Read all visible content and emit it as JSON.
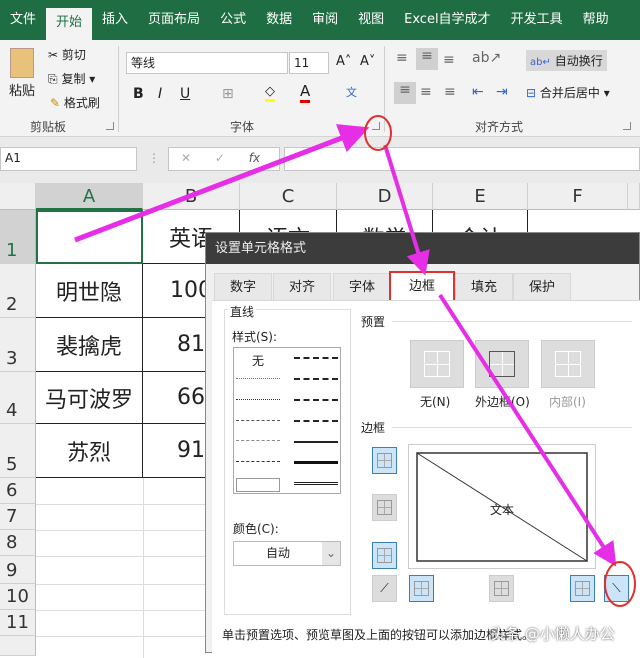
{
  "ribbon_tabs": [
    "文件",
    "开始",
    "插入",
    "页面布局",
    "公式",
    "数据",
    "审阅",
    "视图",
    "Excel自学成才",
    "开发工具",
    "帮助"
  ],
  "clipboard": {
    "paste": "粘贴",
    "cut": "剪切",
    "copy": "复制",
    "format_painter": "格式刷",
    "group": "剪贴板"
  },
  "font": {
    "name": "等线",
    "size": "11",
    "bold": "B",
    "italic": "I",
    "underline": "U",
    "group": "字体"
  },
  "alignment": {
    "wrap": "自动换行",
    "merge": "合并后居中",
    "group": "对齐方式"
  },
  "formula_bar": {
    "name_box": "A1",
    "cancel": "✕",
    "enter": "✓",
    "fx": "fx",
    "value": ""
  },
  "columns": [
    "A",
    "B",
    "C",
    "D",
    "E",
    "F"
  ],
  "rows": [
    "1",
    "2",
    "3",
    "4",
    "5",
    "6",
    "7",
    "8",
    "9",
    "10",
    "11"
  ],
  "cells": {
    "B1": "英语",
    "C1": "语文",
    "D1": "数学",
    "E1": "合计",
    "A2": "明世隐",
    "B2": "100",
    "A3": "裴擒虎",
    "B3": "81",
    "A4": "马可波罗",
    "B4": "66",
    "A5": "苏烈",
    "B5": "91"
  },
  "dialog": {
    "title": "设置单元格格式",
    "tabs": [
      "数字",
      "对齐",
      "字体",
      "边框",
      "填充",
      "保护"
    ],
    "active_tab": "边框",
    "line_section": "直线",
    "style_label": "样式(S):",
    "style_none": "无",
    "color_label": "颜色(C):",
    "color_value": "自动",
    "preset_section": "预置",
    "presets": [
      "无(N)",
      "外边框(O)",
      "内部(I)"
    ],
    "border_section": "边框",
    "preview_text": "文本",
    "hint": "单击预置选项、预览草图及上面的按钮可以添加边框样式。",
    "watermark": "头条 @小懒人办公"
  },
  "annotation_color": "#e62ee6",
  "highlight_color": "#e03030"
}
